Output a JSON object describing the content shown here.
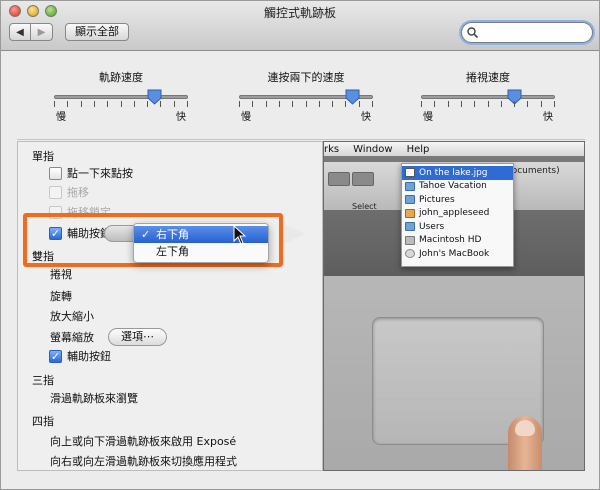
{
  "window": {
    "title": "觸控式軌跡板"
  },
  "toolbar": {
    "back": "◀",
    "forward": "▶",
    "show_all": "顯示全部"
  },
  "search": {
    "value": "",
    "placeholder": ""
  },
  "sliders": [
    {
      "title": "軌跡速度",
      "min_label": "慢",
      "max_label": "快",
      "level": 0.75
    },
    {
      "title": "連按兩下的速度",
      "min_label": "慢",
      "max_label": "快",
      "level": 0.85
    },
    {
      "title": "捲視速度",
      "min_label": "慢",
      "max_label": "快",
      "level": 0.7
    }
  ],
  "one_finger": {
    "header": "單指",
    "tap_to_click": "點一下來點按",
    "dragging": "拖移",
    "drag_lock": "拖移鎖定",
    "secondary_click": "輔助按鈕",
    "secondary_menu": {
      "selected": "右下角",
      "other": "左下角"
    }
  },
  "two_fingers": {
    "header": "雙指",
    "scroll": "捲視",
    "rotate": "旋轉",
    "pinch": "放大縮小",
    "screen_zoom": "螢幕縮放",
    "options_button": "選項⋯",
    "secondary_click": "輔助按鈕"
  },
  "three_fingers": {
    "header": "三指",
    "swipe": "滑過軌跡板來瀏覽"
  },
  "four_fingers": {
    "header": "四指",
    "vertical_swipe": "向上或向下滑過軌跡板來啟用 Exposé",
    "horizontal_swipe": "向右或向左滑過軌跡板來切換應用程式"
  },
  "preview": {
    "menus": [
      "rks",
      "Window",
      "Help"
    ],
    "toolbar_label": "Select",
    "crumb": "documents)",
    "stack_items": [
      {
        "label": "On the lake.jpg",
        "icon": "file-icon",
        "selected": true
      },
      {
        "label": "Tahoe Vacation",
        "icon": "folder-icon"
      },
      {
        "label": "Pictures",
        "icon": "folder-icon"
      },
      {
        "label": "john_appleseed",
        "icon": "home-icon"
      },
      {
        "label": "Users",
        "icon": "folder-icon"
      },
      {
        "label": "Macintosh HD",
        "icon": "hard-drive-icon"
      },
      {
        "label": "John's MacBook",
        "icon": "computer-icon"
      }
    ]
  },
  "colors": {
    "accent": "#2560d6",
    "highlight": "#f26b1d"
  }
}
